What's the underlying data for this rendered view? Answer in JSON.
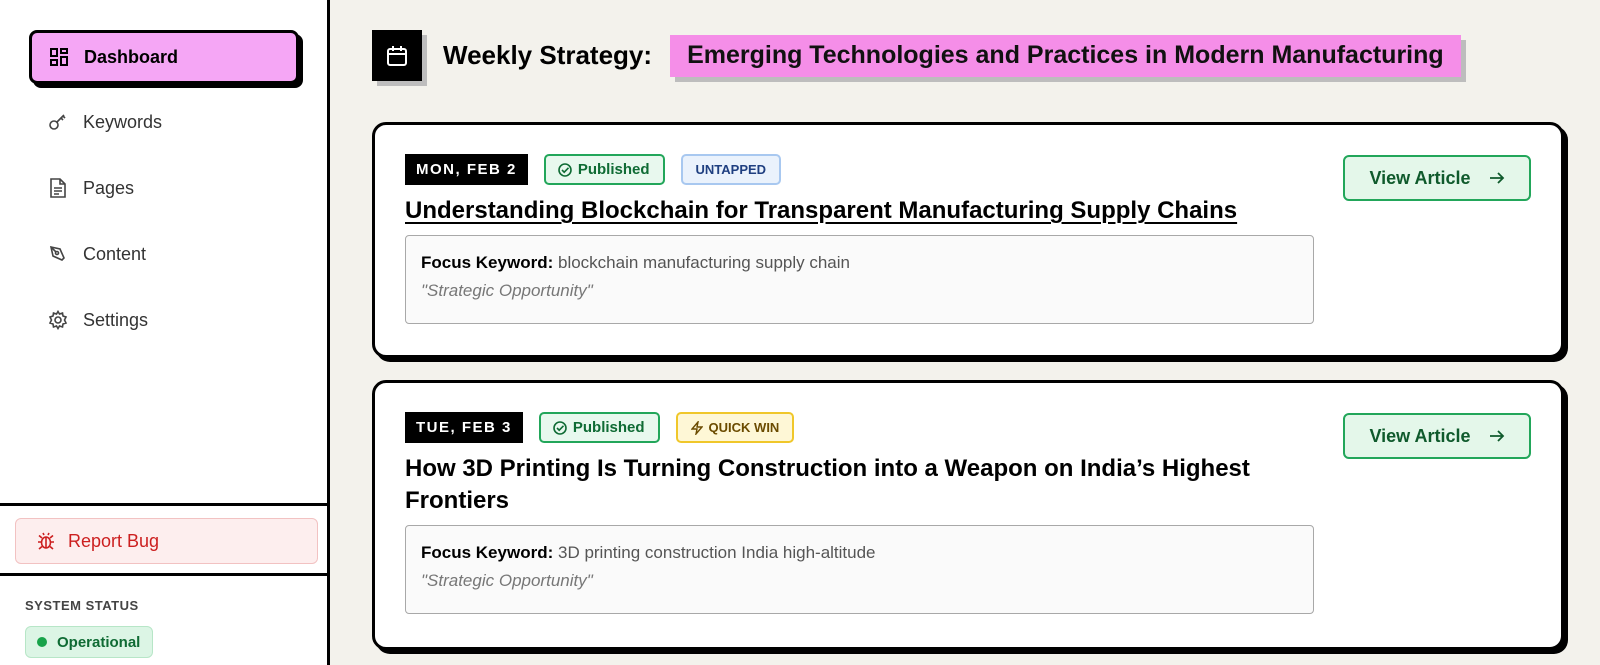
{
  "sidebar": {
    "nav": [
      {
        "label": "Dashboard",
        "icon": "dashboard-icon",
        "active": true
      },
      {
        "label": "Keywords",
        "icon": "key-icon"
      },
      {
        "label": "Pages",
        "icon": "document-icon"
      },
      {
        "label": "Content",
        "icon": "pen-icon"
      },
      {
        "label": "Settings",
        "icon": "gear-icon"
      }
    ],
    "report_bug": "Report Bug",
    "system_status_label": "SYSTEM STATUS",
    "system_status_value": "Operational"
  },
  "header": {
    "title": "Weekly Strategy:",
    "theme": "Emerging Technologies and Practices in Modern Manufacturing"
  },
  "articles": [
    {
      "date": "MON, FEB 2",
      "status": "Published",
      "tag": "UNTAPPED",
      "title": "Understanding Blockchain for Transparent Manufacturing Supply Chains",
      "focus_keyword_label": "Focus Keyword:",
      "focus_keyword": "blockchain manufacturing supply chain",
      "note": "\"Strategic Opportunity\"",
      "button": "View Article"
    },
    {
      "date": "TUE, FEB 3",
      "status": "Published",
      "tag": "QUICK WIN",
      "title": "How 3D Printing Is Turning Construction into a Weapon on India’s Highest Frontiers",
      "focus_keyword_label": "Focus Keyword:",
      "focus_keyword": "3D printing construction India high-altitude",
      "note": "\"Strategic Opportunity\"",
      "button": "View Article"
    }
  ],
  "colors": {
    "active_nav": "#f5a6f5",
    "theme_highlight": "#f58ee8",
    "success": "#22a65a",
    "danger": "#cc1f1f",
    "background": "#f3f2ec"
  }
}
